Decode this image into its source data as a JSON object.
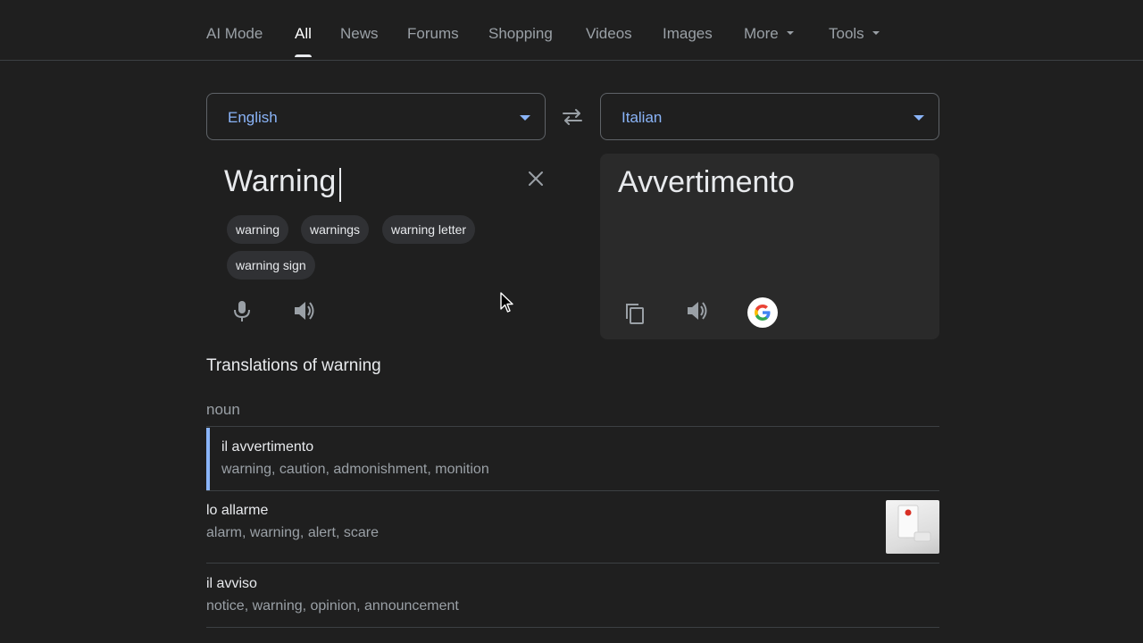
{
  "tabs": [
    {
      "label": "AI Mode"
    },
    {
      "label": "All",
      "active": true
    },
    {
      "label": "News"
    },
    {
      "label": "Forums"
    },
    {
      "label": "Shopping"
    },
    {
      "label": "Videos"
    },
    {
      "label": "Images"
    },
    {
      "label": "More",
      "has_dropdown": true
    },
    {
      "label": "Tools",
      "has_dropdown": true
    }
  ],
  "translator": {
    "source_language": "English",
    "target_language": "Italian",
    "source_text": "Warning",
    "target_text": "Avvertimento",
    "suggestions": [
      "warning",
      "warnings",
      "warning letter",
      "warning sign"
    ],
    "icons": {
      "swap": "swap-icon",
      "clear": "close-icon",
      "mic": "microphone-icon",
      "source_speaker": "speaker-icon",
      "copy": "copy-icon",
      "target_speaker": "speaker-icon",
      "google": "google-logo-icon"
    }
  },
  "translations": {
    "heading": "Translations of warning",
    "part_of_speech": "noun",
    "rows": [
      {
        "word": "il avvertimento",
        "synonyms": "warning, caution, admonishment, monition",
        "selected": true
      },
      {
        "word": "lo allarme",
        "synonyms": "alarm, warning, alert, scare",
        "has_image": true
      },
      {
        "word": "il avviso",
        "synonyms": "notice, warning, opinion, announcement"
      }
    ]
  },
  "colors": {
    "background": "#1f1f1f",
    "accent": "#8ab4f8",
    "text": "#e8eaed",
    "muted": "#9aa0a6"
  }
}
